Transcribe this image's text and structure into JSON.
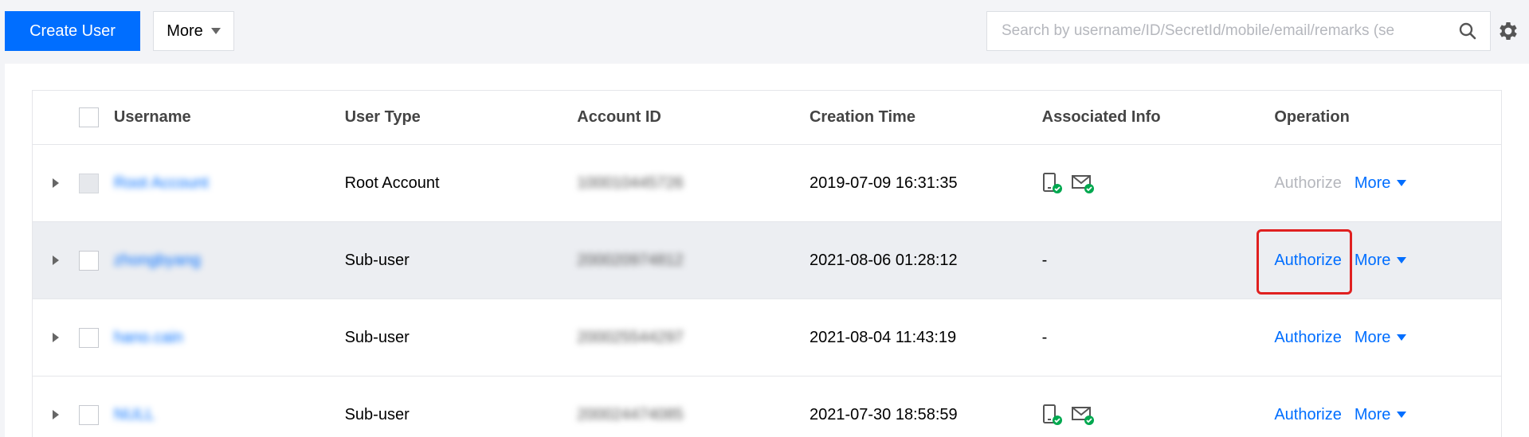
{
  "toolbar": {
    "create_user_label": "Create User",
    "more_label": "More",
    "search_placeholder": "Search by username/ID/SecretId/mobile/email/remarks (se"
  },
  "table": {
    "columns": [
      "Username",
      "User Type",
      "Account ID",
      "Creation Time",
      "Associated Info",
      "Operation"
    ],
    "rows": [
      {
        "username": "Root Account",
        "user_type": "Root Account",
        "account_id": "100010445726",
        "creation_time": "2019-07-09 16:31:35",
        "associated_info": "",
        "authorize_label": "Authorize",
        "more_label": "More"
      },
      {
        "username": "zhongbyang",
        "user_type": "Sub-user",
        "account_id": "200020974812",
        "creation_time": "2021-08-06 01:28:12",
        "associated_info": "-",
        "authorize_label": "Authorize",
        "more_label": "More"
      },
      {
        "username": "hano.cain",
        "user_type": "Sub-user",
        "account_id": "200025544297",
        "creation_time": "2021-08-04 11:43:19",
        "associated_info": "-",
        "authorize_label": "Authorize",
        "more_label": "More"
      },
      {
        "username": "NULL",
        "user_type": "Sub-user",
        "account_id": "200024474085",
        "creation_time": "2021-07-30 18:58:59",
        "associated_info": "",
        "authorize_label": "Authorize",
        "more_label": "More"
      }
    ]
  },
  "icons": {
    "search": "search-icon",
    "settings": "gear-icon",
    "phone_verified": "phone-verified-icon",
    "email_verified": "email-verified-icon"
  },
  "colors": {
    "primary": "#006eff",
    "verified": "#00a84f",
    "highlight_border": "#e02020",
    "disabled_text": "#b5b7bd"
  }
}
